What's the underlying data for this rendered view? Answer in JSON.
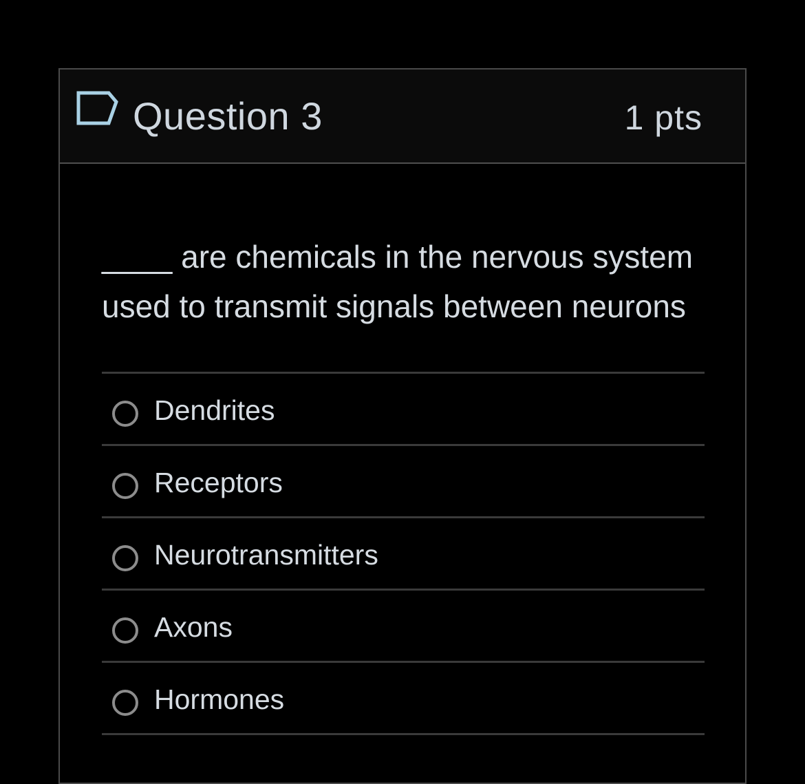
{
  "question": {
    "title": "Question 3",
    "points": "1 pts",
    "flag_icon": "flag-bookmark-icon",
    "text_line1": "____ are chemicals in the nervous system",
    "text_line2": "used to transmit signals between neurons"
  },
  "answers": [
    {
      "label": "Dendrites",
      "selected": false
    },
    {
      "label": "Receptors",
      "selected": false
    },
    {
      "label": "Neurotransmitters",
      "selected": false
    },
    {
      "label": "Axons",
      "selected": false
    },
    {
      "label": "Hormones",
      "selected": false
    }
  ],
  "colors": {
    "background": "#000000",
    "header_background": "#0b0b0b",
    "border": "#4a4a4a",
    "text": "#d6dce2",
    "radio_border": "#8c8c8c"
  }
}
